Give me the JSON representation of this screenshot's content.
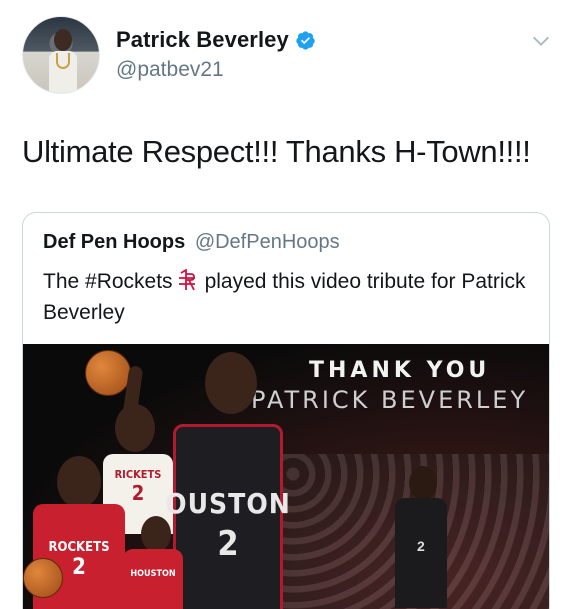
{
  "tweet": {
    "display_name": "Patrick Beverley",
    "handle": "@patbev21",
    "text": "Ultimate Respect!!! Thanks H-Town!!!!",
    "verified": true,
    "menu_icon": "chevron-down-icon"
  },
  "quoted_tweet": {
    "display_name": "Def Pen Hoops",
    "handle": "@DefPenHoops",
    "text_before_emoji": "The #Rockets",
    "emoji": "rockets-logo-icon",
    "text_after_emoji": "played this video tribute for Patrick Beverley"
  },
  "media": {
    "overlay_line1": "THANK YOU",
    "overlay_line2": "PATRICK BEVERLEY",
    "jersey_center_text": "OUSTON",
    "jersey_center_number": "2",
    "jersey_left_text": "ROCKETS",
    "jersey_left_number": "2",
    "jersey_back_text": "RICKETS",
    "jersey_back_number": "2",
    "jersey_small_text": "HOUSTON",
    "jersey_right_number": "2"
  },
  "colors": {
    "text_primary": "#14171a",
    "text_secondary": "#657786",
    "verified_blue": "#1da1f2",
    "rockets_red": "#ce1141",
    "border": "#ccd6dd"
  }
}
